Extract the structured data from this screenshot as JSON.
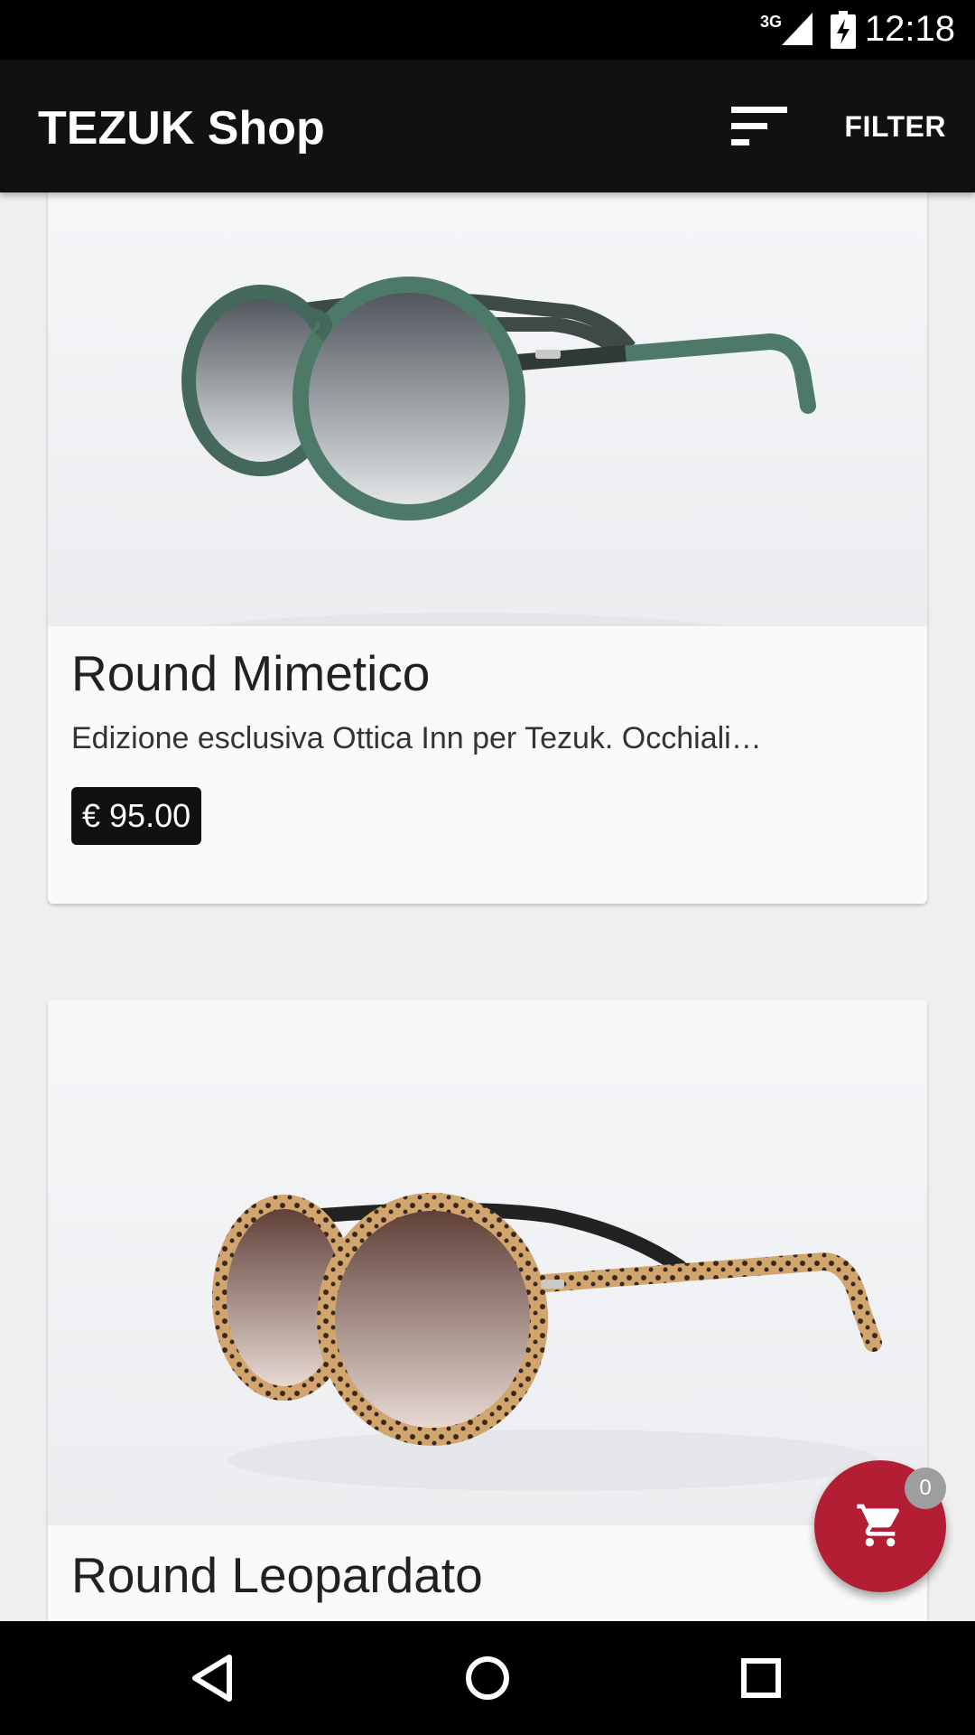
{
  "status_bar": {
    "network": "3G",
    "time": "12:18"
  },
  "app_bar": {
    "title": "TEZUK Shop",
    "filter_label": "FILTER",
    "sort_icon": "sort-icon"
  },
  "products": [
    {
      "name": "Round Mimetico",
      "description": "Edizione esclusiva Ottica Inn per Tezuk. Occhiali…",
      "price": "€ 95.00",
      "frame_style": "green camouflage",
      "lens_tint": "grey gradient"
    },
    {
      "name": "Round Leopardato",
      "frame_style": "leopard print",
      "lens_tint": "brown gradient"
    }
  ],
  "cart": {
    "count": "0",
    "icon": "shopping-cart-icon"
  },
  "colors": {
    "app_bar": "#111111",
    "fab": "#b31e35",
    "price_badge": "#111111",
    "background": "#efefef"
  },
  "nav_bar": {
    "back_icon": "back-icon",
    "home_icon": "home-icon",
    "recents_icon": "recents-icon"
  }
}
